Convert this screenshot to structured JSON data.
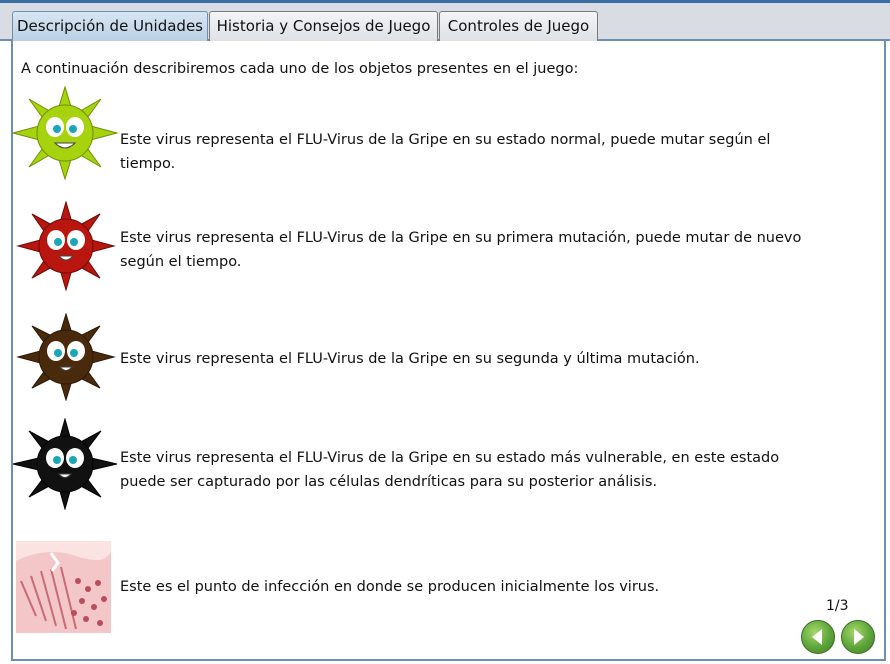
{
  "tabs": [
    {
      "label": "Descripción de Unidades",
      "active": true
    },
    {
      "label": "Historia y Consejos de Juego",
      "active": false
    },
    {
      "label": "Controles de Juego",
      "active": false
    }
  ],
  "intro": "A continuación describiremos cada uno de los objetos presentes en el juego:",
  "units": [
    {
      "icon": "green-virus-icon",
      "color": "#a6d20e",
      "text": "Este virus representa el FLU-Virus de la Gripe en su estado normal, puede mutar según el tiempo."
    },
    {
      "icon": "red-virus-icon",
      "color": "#b8160f",
      "text": "Este virus representa el FLU-Virus de la Gripe en su primera mutación, puede mutar de nuevo según el tiempo."
    },
    {
      "icon": "brown-virus-icon",
      "color": "#4a2a0c",
      "text": "Este virus representa el FLU-Virus de la Gripe en su segunda y última mutación."
    },
    {
      "icon": "black-virus-icon",
      "color": "#111111",
      "text": "Este virus representa el FLU-Virus de la Gripe en su estado más vulnerable, en este estado puede ser capturado por las células dendríticas para su posterior análisis."
    },
    {
      "icon": "tissue-icon",
      "color": "#e8a2a8",
      "text": "Este es el punto de infección en donde se producen inicialmente los virus."
    }
  ],
  "pagination": {
    "label": "1/3"
  },
  "nav": {
    "prev_icon": "arrow-left-icon",
    "next_icon": "arrow-right-icon"
  }
}
